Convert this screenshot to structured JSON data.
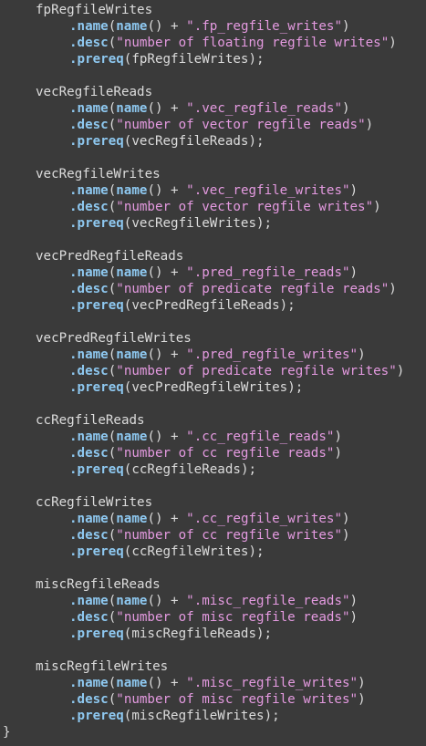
{
  "blocks": [
    {
      "name": "fpRegfileWrites",
      "suffix": ".fp_regfile_writes",
      "desc": "number of floating regfile writes"
    },
    {
      "name": "vecRegfileReads",
      "suffix": ".vec_regfile_reads",
      "desc": "number of vector regfile reads"
    },
    {
      "name": "vecRegfileWrites",
      "suffix": ".vec_regfile_writes",
      "desc": "number of vector regfile writes"
    },
    {
      "name": "vecPredRegfileReads",
      "suffix": ".pred_regfile_reads",
      "desc": "number of predicate regfile reads"
    },
    {
      "name": "vecPredRegfileWrites",
      "suffix": ".pred_regfile_writes",
      "desc": "number of predicate regfile writes"
    },
    {
      "name": "ccRegfileReads",
      "suffix": ".cc_regfile_reads",
      "desc": "number of cc regfile reads"
    },
    {
      "name": "ccRegfileWrites",
      "suffix": ".cc_regfile_writes",
      "desc": "number of cc regfile writes"
    },
    {
      "name": "miscRegfileReads",
      "suffix": ".misc_regfile_reads",
      "desc": "number of misc regfile reads"
    },
    {
      "name": "miscRegfileWrites",
      "suffix": ".misc_regfile_writes",
      "desc": "number of misc regfile writes"
    }
  ],
  "tokens": {
    "name_method": ".name",
    "name_fn": "name",
    "desc_method": ".desc",
    "prereq_method": ".prereq",
    "closing_brace": "}"
  },
  "colors": {
    "background": "#3a3a3a",
    "text": "#dcdcdc",
    "keyword": "#8ec8f0",
    "string": "#e49ae0"
  }
}
